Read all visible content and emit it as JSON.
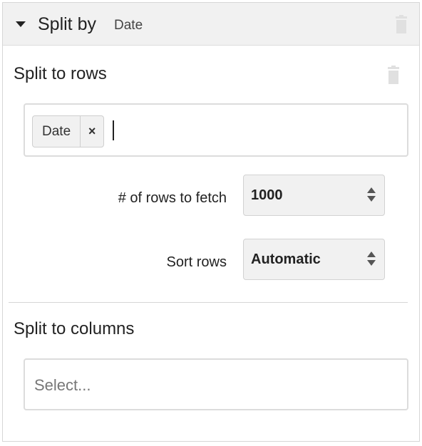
{
  "header": {
    "title": "Split by",
    "subtitle": "Date",
    "collapse_icon": "caret-down-icon",
    "delete_icon": "trash-icon"
  },
  "rows_section": {
    "title": "Split to rows",
    "delete_icon": "trash-icon",
    "tags": [
      {
        "label": "Date",
        "remove_label": "×"
      }
    ],
    "fetch_label": "# of rows to fetch",
    "fetch_value": "1000",
    "sort_label": "Sort rows",
    "sort_value": "Automatic"
  },
  "columns_section": {
    "title": "Split to columns",
    "placeholder": "Select..."
  },
  "colors": {
    "header_bg": "#f1f1f1",
    "border": "#d6d6d6",
    "text": "#222222",
    "icon_muted": "#e0e0e0",
    "select_bg": "#f1f1f1"
  }
}
